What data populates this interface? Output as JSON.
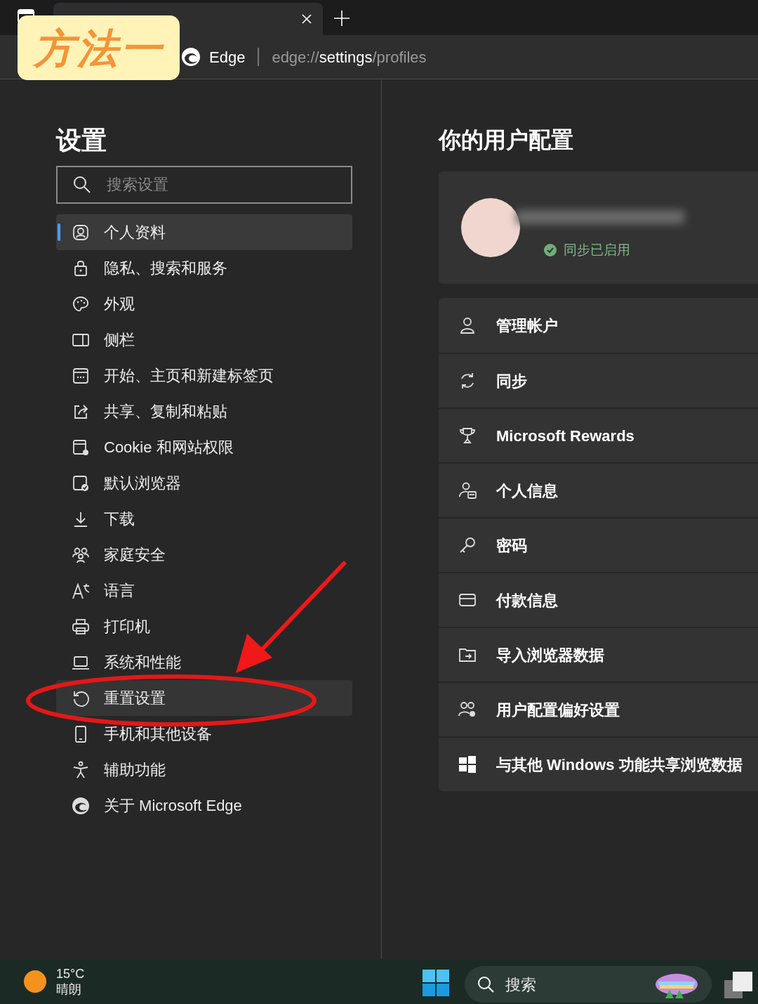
{
  "annotation": {
    "label": "方法一"
  },
  "address_bar": {
    "site": "Edge",
    "url_prefix": "edge://",
    "url_main": "settings",
    "url_suffix": "/profiles"
  },
  "sidebar": {
    "title": "设置",
    "search": {
      "placeholder": "搜索设置"
    },
    "items": [
      {
        "label": "个人资料",
        "selected": true,
        "hovered": false
      },
      {
        "label": "隐私、搜索和服务",
        "selected": false,
        "hovered": false
      },
      {
        "label": "外观",
        "selected": false,
        "hovered": false
      },
      {
        "label": "侧栏",
        "selected": false,
        "hovered": false
      },
      {
        "label": "开始、主页和新建标签页",
        "selected": false,
        "hovered": false
      },
      {
        "label": "共享、复制和粘贴",
        "selected": false,
        "hovered": false
      },
      {
        "label": "Cookie 和网站权限",
        "selected": false,
        "hovered": false
      },
      {
        "label": "默认浏览器",
        "selected": false,
        "hovered": false
      },
      {
        "label": "下载",
        "selected": false,
        "hovered": false
      },
      {
        "label": "家庭安全",
        "selected": false,
        "hovered": false
      },
      {
        "label": "语言",
        "selected": false,
        "hovered": false
      },
      {
        "label": "打印机",
        "selected": false,
        "hovered": false
      },
      {
        "label": "系统和性能",
        "selected": false,
        "hovered": false
      },
      {
        "label": "重置设置",
        "selected": false,
        "hovered": true
      },
      {
        "label": "手机和其他设备",
        "selected": false,
        "hovered": false
      },
      {
        "label": "辅助功能",
        "selected": false,
        "hovered": false
      },
      {
        "label": "关于 Microsoft Edge",
        "selected": false,
        "hovered": false
      }
    ]
  },
  "main": {
    "title": "你的用户配置",
    "profile": {
      "sync_status": "同步已启用"
    },
    "rows": [
      {
        "label": "管理帐户"
      },
      {
        "label": "同步"
      },
      {
        "label": "Microsoft Rewards"
      },
      {
        "label": "个人信息"
      },
      {
        "label": "密码"
      },
      {
        "label": "付款信息"
      },
      {
        "label": "导入浏览器数据"
      },
      {
        "label": "用户配置偏好设置"
      },
      {
        "label": "与其他 Windows 功能共享浏览数据"
      }
    ]
  },
  "taskbar": {
    "temperature": "15°C",
    "weather": "晴朗",
    "search": "搜索"
  }
}
